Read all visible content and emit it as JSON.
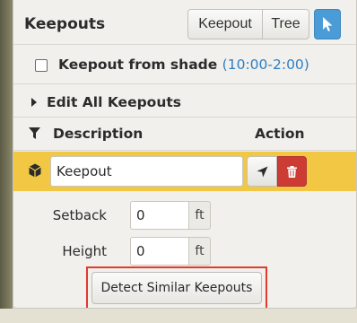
{
  "panel": {
    "title": "Keepouts",
    "view_toggle": {
      "options": [
        "Keepout",
        "Tree"
      ]
    },
    "select_tool_icon": "cursor-pointer-icon"
  },
  "shade_option": {
    "label": "Keepout from shade",
    "time_range": "(10:00-2:00)",
    "checked": false
  },
  "edit_all": {
    "label": "Edit All Keepouts"
  },
  "table": {
    "headers": {
      "description": "Description",
      "action": "Action"
    },
    "rows": [
      {
        "name": "Keepout",
        "setback_label": "Setback",
        "setback_value": "0",
        "height_label": "Height",
        "height_value": "0",
        "unit": "ft"
      }
    ]
  },
  "detect_button": {
    "label": "Detect Similar Keepouts"
  },
  "colors": {
    "selected_row": "#f2c744",
    "accent_blue": "#4a9bd6",
    "delete_red": "#cc3c34",
    "highlight_border": "#e23a2e",
    "time_text": "#2f7fc4"
  }
}
